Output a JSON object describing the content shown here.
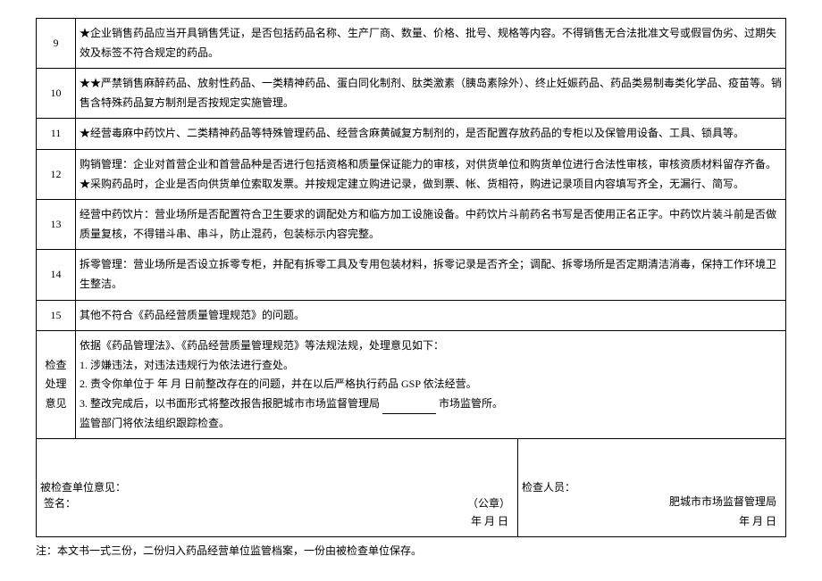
{
  "rows": [
    {
      "num": "9",
      "text": "★企业销售药品应当开具销售凭证，是否包括药品名称、生产厂商、数量、价格、批号、规格等内容。不得销售无合法批准文号或假冒伪劣、过期失效及标签不符合规定的药品。"
    },
    {
      "num": "10",
      "text": "★★严禁销售麻醉药品、放射性药品、一类精神药品、蛋白同化制剂、肽类激素（胰岛素除外）、终止妊娠药品、药品类易制毒类化学品、疫苗等。销售含特殊药品复方制剂是否按规定实施管理。"
    },
    {
      "num": "11",
      "text": "★经营毒麻中药饮片、二类精神药品等特殊管理药品、经营含麻黄碱复方制剂的，是否配置存放药品的专柜以及保管用设备、工具、锁具等。"
    },
    {
      "num": "12",
      "text": "购销管理：企业对首营企业和首营品种是否进行包括资格和质量保证能力的审核，对供货单位和购货单位进行合法性审核，审核资质材料留存齐备。★采购药品时，企业是否向供货单位索取发票。并按规定建立购进记录，做到票、帐、货相符，购进记录项目内容填写齐全，无漏行、简写。"
    },
    {
      "num": "13",
      "text": "经营中药饮片：营业场所是否配置符合卫生要求的调配处方和临方加工设施设备。中药饮片斗前药名书写是否使用正名正字。中药饮片装斗前是否做质量复核，不得错斗串、串斗，防止混药，包装标示内容完整。"
    },
    {
      "num": "14",
      "text": "拆零管理：营业场所是否设立拆零专柜，并配有拆零工具及专用包装材料，拆零记录是否齐全；调配、拆零场所是否定期清洁消毒，保持工作环境卫生整洁。"
    },
    {
      "num": "15",
      "text": "其他不符合《药品经营质量管理规范》的问题。"
    }
  ],
  "opinion_label": "检查处理意见",
  "opinion_lines": {
    "l0": "依据《药品管理法》、《药品经营质量管理规范》等法规法规，处理意见如下：",
    "l1": "1. 涉嫌违法，对违法违规行为依法进行查处。",
    "l2_a": "2. 责令你单位于 年 月 日前整改存在的问题，并在以后严格执行药品 GSP 依法经营。",
    "l3_a": "3. 整改完成后，以书面形式将整改报告报肥城市市场监督管理局",
    "l3_b": "市场监管所。",
    "l4": "监管部门将依法组织跟踪检查。"
  },
  "checked_unit_label": "被检查单位意见：",
  "sign_label": "签名：",
  "seal_label": "（公章）",
  "date_label": "年 月 日",
  "inspector_label": "检查人员：",
  "agency": "肥城市市场监督管理局",
  "footnote": "注：本文书一式三份，二份归入药品经营单位监管档案，一份由被检查单位保存。"
}
